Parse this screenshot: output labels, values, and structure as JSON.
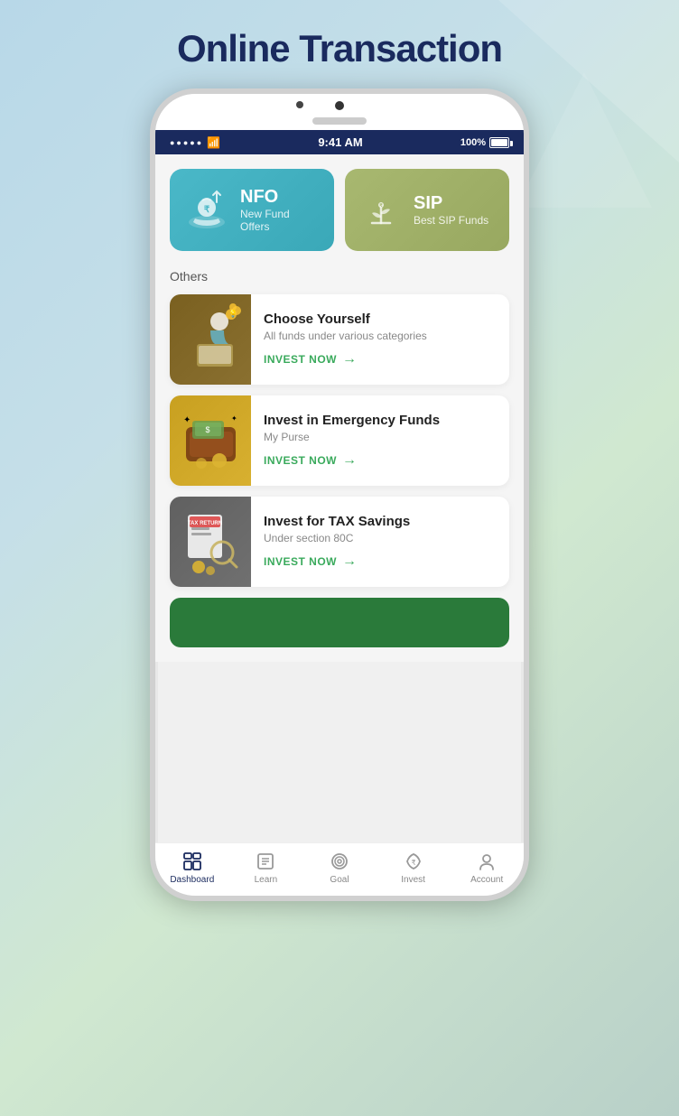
{
  "page": {
    "title": "Online Transaction",
    "background": "gradient"
  },
  "statusBar": {
    "dots": "●●●●●",
    "time": "9:41 AM",
    "battery": "100%"
  },
  "topCards": [
    {
      "id": "nfo",
      "title": "NFO",
      "subtitle": "New Fund Offers",
      "bgColor": "#4ab8c8"
    },
    {
      "id": "sip",
      "title": "SIP",
      "subtitle": "Best SIP Funds",
      "bgColor": "#a8b870"
    }
  ],
  "othersLabel": "Others",
  "listItems": [
    {
      "id": "choose-yourself",
      "title": "Choose Yourself",
      "subtitle": "All funds under various categories",
      "cta": "INVEST NOW",
      "thumbColor": "#7a6020"
    },
    {
      "id": "emergency-funds",
      "title": "Invest in Emergency Funds",
      "subtitle": "My Purse",
      "cta": "INVEST NOW",
      "thumbColor": "#c8a020"
    },
    {
      "id": "tax-savings",
      "title": "Invest for TAX Savings",
      "subtitle": "Under section 80C",
      "cta": "INVEST NOW",
      "thumbColor": "#606060"
    }
  ],
  "bottomNav": [
    {
      "id": "dashboard",
      "label": "Dashboard",
      "active": true
    },
    {
      "id": "learn",
      "label": "Learn",
      "active": false
    },
    {
      "id": "goal",
      "label": "Goal",
      "active": false
    },
    {
      "id": "invest",
      "label": "Invest",
      "active": false
    },
    {
      "id": "account",
      "label": "Account",
      "active": false
    }
  ]
}
